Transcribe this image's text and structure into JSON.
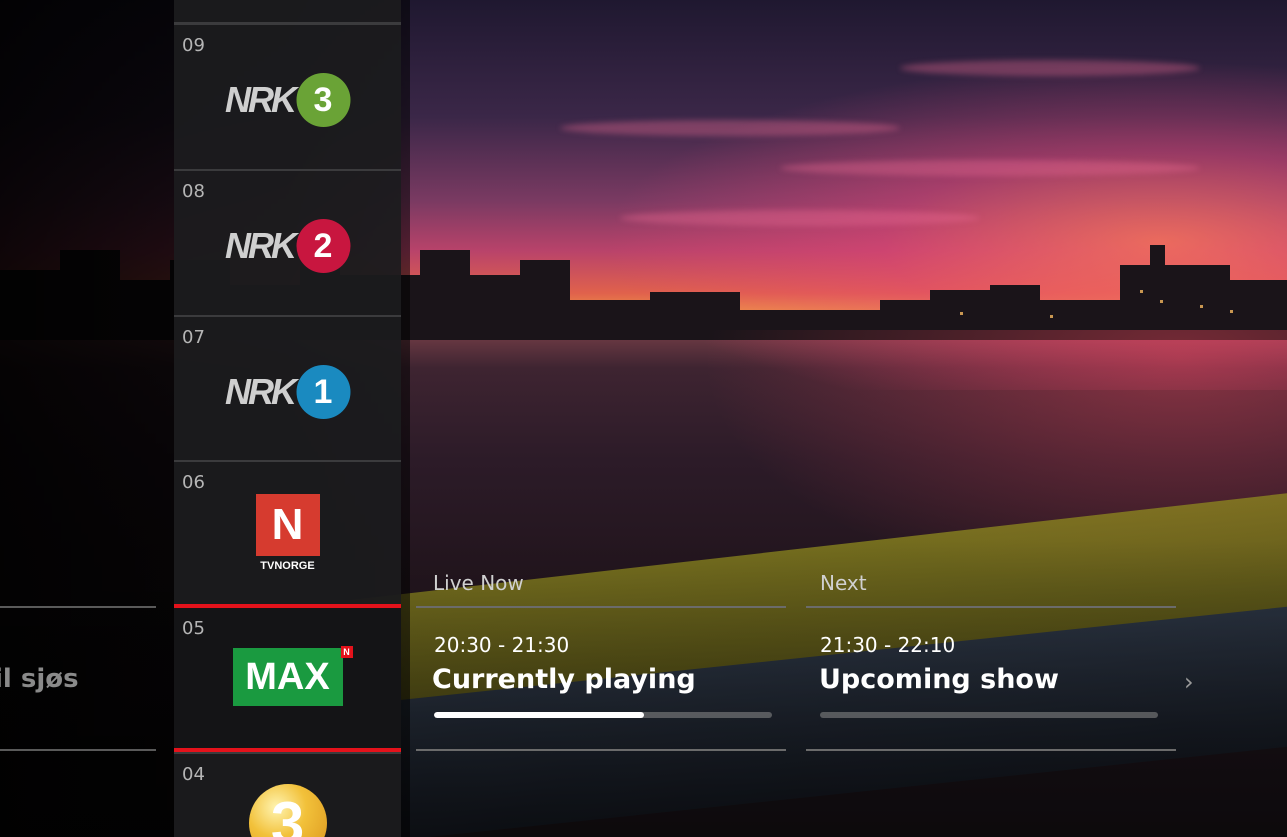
{
  "previous_programme": {
    "title": "il sjøs"
  },
  "channels": [
    {
      "number": "09",
      "logo": "nrk3-logo",
      "logo_text": "NRK",
      "badge": "3",
      "color": "#6aa336"
    },
    {
      "number": "08",
      "logo": "nrk2-logo",
      "logo_text": "NRK",
      "badge": "2",
      "color": "#c8163f"
    },
    {
      "number": "07",
      "logo": "nrk1-logo",
      "logo_text": "NRK",
      "badge": "1",
      "color": "#1a8ac0"
    },
    {
      "number": "06",
      "logo": "tvnorge-logo",
      "logo_text": "N",
      "sub_label": "TVNORGE",
      "color": "#d63b2f"
    },
    {
      "number": "05",
      "logo": "max-logo",
      "logo_text": "MAX",
      "badge": "N",
      "color": "#1a9a40",
      "selected": true
    },
    {
      "number": "04",
      "logo": "tv3-logo",
      "logo_text": "3",
      "color": "#f2c13a"
    }
  ],
  "live_now": {
    "header": "Live Now",
    "time": "20:30 - 21:30",
    "title": "Currently playing",
    "progress": 0.62
  },
  "next": {
    "header": "Next",
    "time": "21:30 - 22:10",
    "title": "Upcoming show",
    "progress": 0
  },
  "icons": {
    "next_arrow": "chevron-right-icon"
  },
  "colors": {
    "selection_accent": "#e4121b",
    "progress_fill": "#ffffff"
  }
}
